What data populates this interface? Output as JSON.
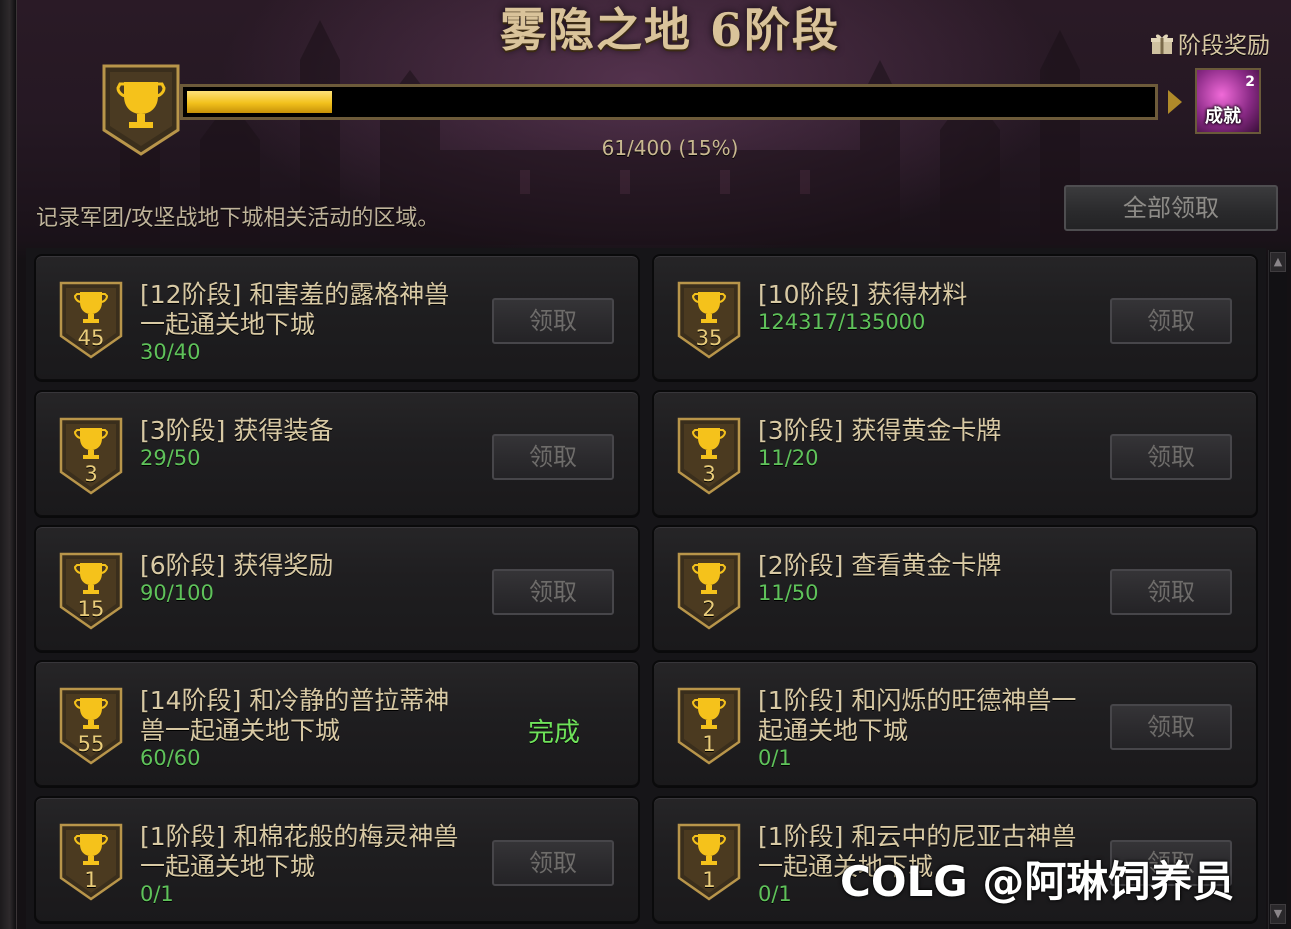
{
  "header": {
    "title": "雾隐之地 6阶段",
    "stage_reward_label": "阶段奖励",
    "reward_badge_label": "成就",
    "reward_badge_count": "2",
    "progress_text": "61/400 (15%)",
    "progress_fraction": 0.15,
    "description": "记录军团/攻坚战地下城相关活动的区域。",
    "claim_all_label": "全部领取"
  },
  "colors": {
    "accent_gold": "#f2c11c",
    "progress_green": "#5fc25a",
    "done_green": "#6fe25a",
    "text_beige": "#d8c9a4"
  },
  "missions": [
    {
      "points": "45",
      "title_lines": [
        "[12阶段] 和害羞的露格神兽",
        "一起通关地下城"
      ],
      "progress": "30/40",
      "action": "领取",
      "done": false
    },
    {
      "points": "35",
      "title_lines": [
        "[10阶段] 获得材料",
        ""
      ],
      "progress": "124317/135000",
      "action": "领取",
      "done": false
    },
    {
      "points": "3",
      "title_lines": [
        "[3阶段] 获得装备",
        ""
      ],
      "progress": "29/50",
      "action": "领取",
      "done": false
    },
    {
      "points": "3",
      "title_lines": [
        "[3阶段] 获得黄金卡牌",
        ""
      ],
      "progress": "11/20",
      "action": "领取",
      "done": false
    },
    {
      "points": "15",
      "title_lines": [
        "[6阶段] 获得奖励",
        ""
      ],
      "progress": "90/100",
      "action": "领取",
      "done": false
    },
    {
      "points": "2",
      "title_lines": [
        "[2阶段] 查看黄金卡牌",
        ""
      ],
      "progress": "11/50",
      "action": "领取",
      "done": false
    },
    {
      "points": "55",
      "title_lines": [
        "[14阶段] 和冷静的普拉蒂神",
        "兽一起通关地下城"
      ],
      "progress": "60/60",
      "action": "完成",
      "done": true
    },
    {
      "points": "1",
      "title_lines": [
        "[1阶段] 和闪烁的旺德神兽一",
        "起通关地下城"
      ],
      "progress": "0/1",
      "action": "领取",
      "done": false
    },
    {
      "points": "1",
      "title_lines": [
        "[1阶段] 和棉花般的梅灵神兽",
        "一起通关地下城"
      ],
      "progress": "0/1",
      "action": "领取",
      "done": false
    },
    {
      "points": "1",
      "title_lines": [
        "[1阶段] 和云中的尼亚古神兽",
        "一起通关地下城"
      ],
      "progress": "0/1",
      "action": "领取",
      "done": false
    }
  ],
  "icons": {
    "trophy": "trophy-icon",
    "gift": "gift-icon",
    "arrow": "arrow-right-icon"
  },
  "watermark": "COLG @阿琳饲养员"
}
